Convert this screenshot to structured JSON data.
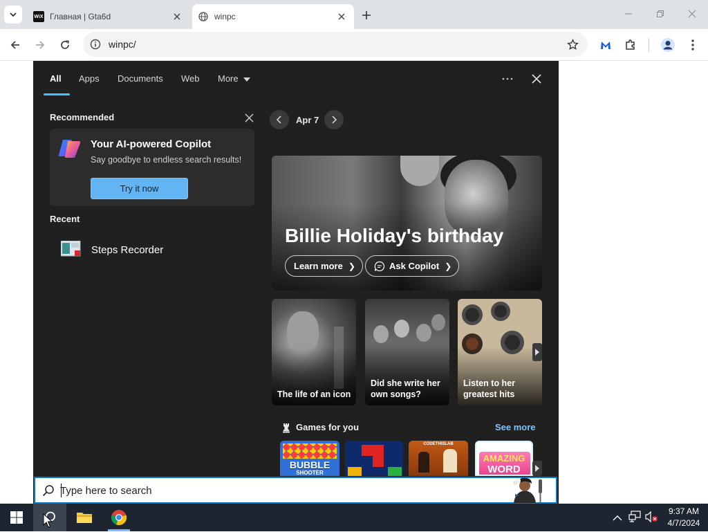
{
  "browser": {
    "tabs": [
      {
        "title": "Главная | Gta6d",
        "favicon": "wix-favicon",
        "active": false
      },
      {
        "title": "winpc",
        "favicon": "globe-icon",
        "active": true
      }
    ],
    "wix_favicon_text": "WiX",
    "url": "winpc/"
  },
  "search_panel": {
    "nav_tabs": [
      "All",
      "Apps",
      "Documents",
      "Web",
      "More"
    ],
    "recommended": {
      "heading": "Recommended",
      "card_title": "Your AI-powered Copilot",
      "card_subtitle": "Say goodbye to endless search results!",
      "button_label": "Try it now"
    },
    "recent": {
      "heading": "Recent",
      "items": [
        {
          "label": "Steps Recorder",
          "icon": "steps-recorder-icon"
        }
      ]
    },
    "date": "Apr 7",
    "hero": {
      "title": "Billie Holiday's birthday",
      "learn_more": "Learn more",
      "ask_copilot": "Ask Copilot"
    },
    "stories": [
      {
        "label": "The life of an icon"
      },
      {
        "label": "Did she write her own songs?"
      },
      {
        "label": "Listen to her greatest hits"
      }
    ],
    "games": {
      "heading": "Games for you",
      "see_more": "See more",
      "tile1_line1": "BUBBLE",
      "tile1_line2": "SHOOTER",
      "tile3_label": "CODETHISLAB",
      "tile4_line1": "AMAZING",
      "tile4_line2": "WORD"
    },
    "search_placeholder": "Type here to search"
  },
  "taskbar": {
    "time": "9:37 AM",
    "date": "4/7/2024",
    "apps": [
      "windows-start-icon",
      "search-icon",
      "file-explorer-icon",
      "chrome-icon"
    ]
  },
  "colors": {
    "panel_bg": "#202020",
    "accent": "#4cc2ff",
    "search_border": "#0078d4",
    "taskbar_bg": "#1c2530",
    "try_button": "#62b4f2"
  }
}
